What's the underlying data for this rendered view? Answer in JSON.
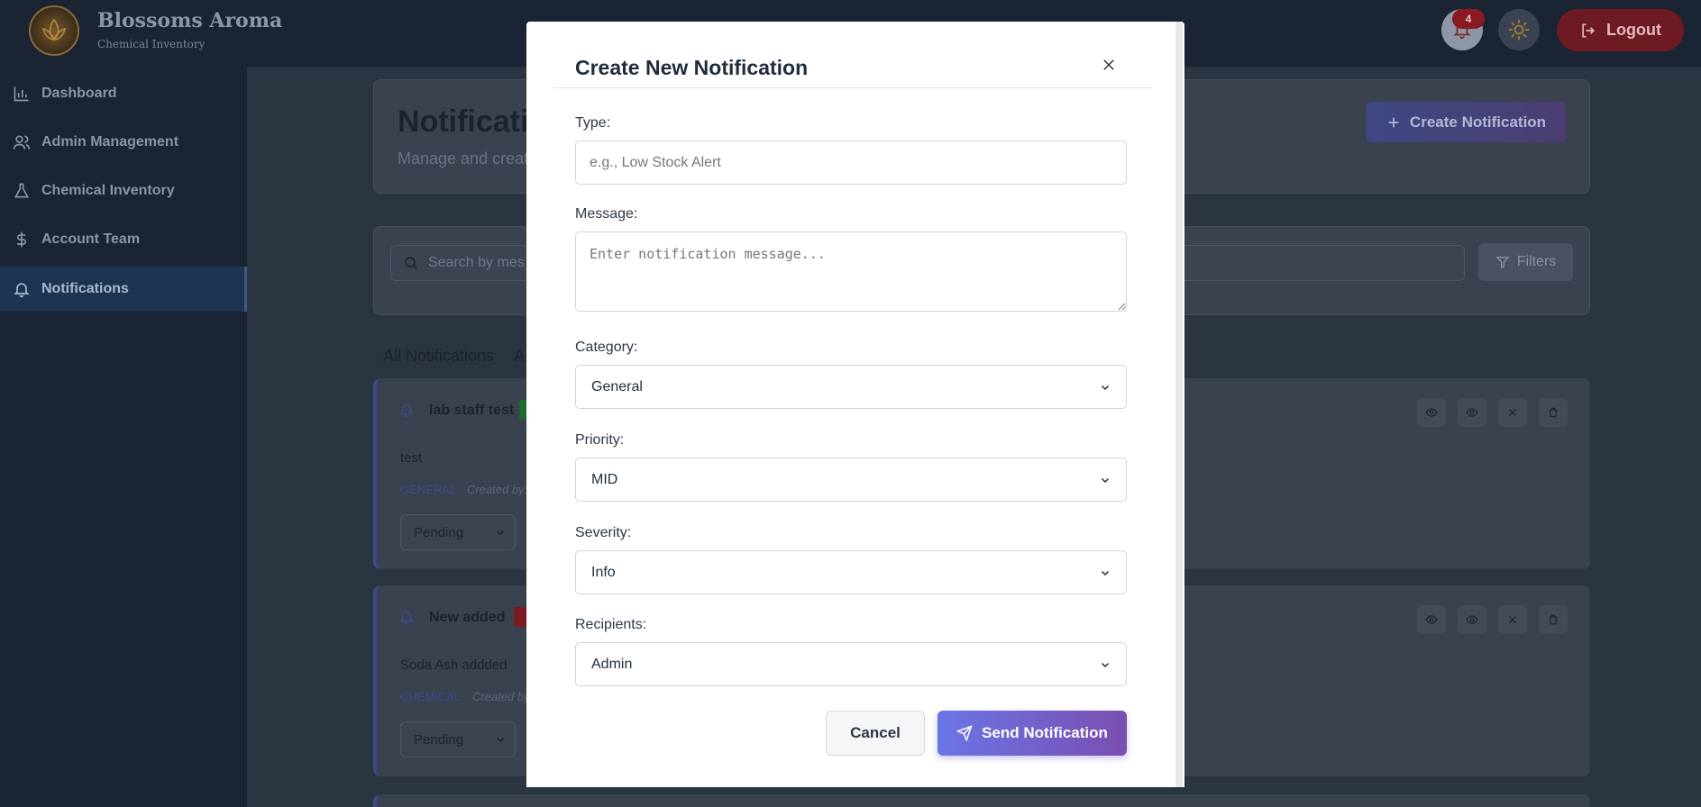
{
  "header": {
    "brand_title": "Blossoms Aroma",
    "brand_subtitle": "Chemical Inventory",
    "notification_count": "4",
    "logout_label": "Logout"
  },
  "sidebar": {
    "items": [
      {
        "label": "Dashboard",
        "icon": "bar-chart-icon"
      },
      {
        "label": "Admin Management",
        "icon": "users-icon"
      },
      {
        "label": "Chemical Inventory",
        "icon": "flask-icon"
      },
      {
        "label": "Account Team",
        "icon": "dollar-icon"
      },
      {
        "label": "Notifications",
        "icon": "bell-icon",
        "active": true
      }
    ]
  },
  "main": {
    "title": "Notificatio",
    "subtitle": "Manage and creat",
    "create_button": "Create Notification",
    "search_placeholder": "Search by mes",
    "filters_label": "Filters",
    "tabs": [
      "All Notifications",
      "A"
    ],
    "notifications": [
      {
        "title": "lab staff test",
        "message": "test",
        "category": "GENERAL",
        "created_by": "Created by:",
        "status": "Pending",
        "tag_color": "#1e6b2c"
      },
      {
        "title": "New added",
        "message": "Soda Ash addded",
        "category": "CHEMICAL",
        "created_by": "Created by",
        "status": "Pending",
        "tag_color": "#7a1a22"
      }
    ]
  },
  "modal": {
    "title": "Create New Notification",
    "type_label": "Type:",
    "type_placeholder": "e.g., Low Stock Alert",
    "message_label": "Message:",
    "message_placeholder": "Enter notification message...",
    "category_label": "Category:",
    "category_value": "General",
    "priority_label": "Priority:",
    "priority_value": "MID",
    "severity_label": "Severity:",
    "severity_value": "Info",
    "recipients_label": "Recipients:",
    "recipients_value": "Admin",
    "cancel_label": "Cancel",
    "send_label": "Send Notification"
  },
  "colors": {
    "accent_start": "#6a75e6",
    "accent_end": "#7a4fb0",
    "logout": "#c0272f",
    "sidebar_bg": "#1a2433"
  }
}
